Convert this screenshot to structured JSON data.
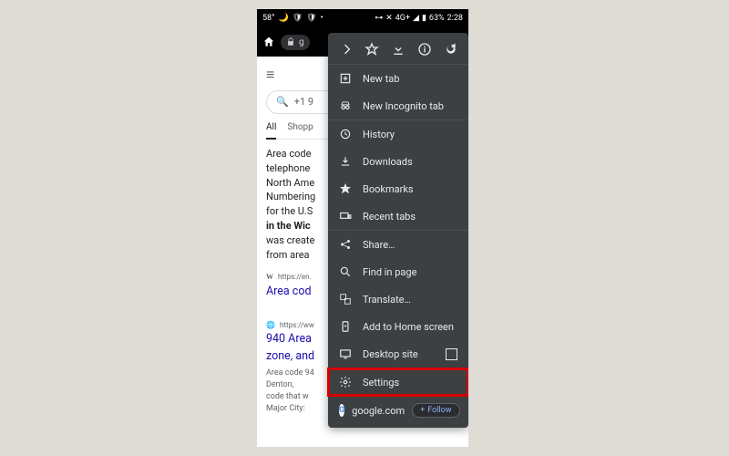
{
  "status": {
    "temp": "58°",
    "network": "4G+",
    "battery": "63%",
    "time": "2:28"
  },
  "url": {
    "text": "g"
  },
  "search": {
    "value": "+1 9"
  },
  "tabs": {
    "all": "All",
    "shopping": "Shopp"
  },
  "snippet": {
    "l1": "Area code",
    "l2": "telephone",
    "l3": "North Ame",
    "l4": "Numbering",
    "l5": "for the U.S",
    "l6": "in the Wic",
    "l7": "was create",
    "l8": "from area"
  },
  "result1": {
    "src_label": "https://en.",
    "src_icon": "W",
    "link": "Area cod"
  },
  "result2": {
    "src_label": "https://ww",
    "link_l1": "940 Area",
    "link_l2": "zone, and",
    "body_l1": "Area code 94",
    "body_l2": "Denton,",
    "body_l3": "code that w",
    "body_l4": "Major City:"
  },
  "menu": {
    "new_tab": "New tab",
    "incognito": "New Incognito tab",
    "history": "History",
    "downloads": "Downloads",
    "bookmarks": "Bookmarks",
    "recent": "Recent tabs",
    "share": "Share…",
    "find": "Find in page",
    "translate": "Translate…",
    "homescreen": "Add to Home screen",
    "desktop": "Desktop site",
    "settings": "Settings",
    "footer_site": "google.com",
    "follow": "Follow"
  }
}
